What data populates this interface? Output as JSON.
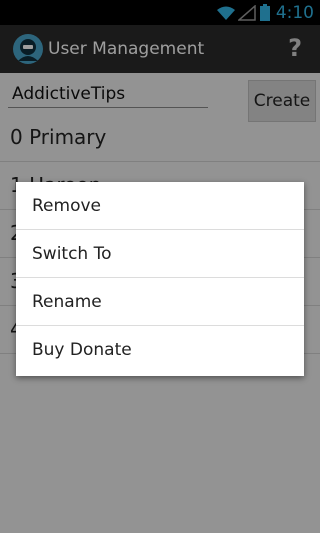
{
  "status_bar": {
    "time": "4:10",
    "icons": [
      "wifi-icon",
      "signal-icon",
      "battery-icon"
    ]
  },
  "action_bar": {
    "title": "User Management",
    "help_label": "?",
    "app_icon": "app-avatar-icon"
  },
  "form": {
    "name_value": "AddictiveTips",
    "create_label": "Create"
  },
  "users": [
    {
      "label": "0 Primary"
    },
    {
      "label": "1 Haroon"
    },
    {
      "label": "2"
    },
    {
      "label": "3"
    },
    {
      "label": "4"
    }
  ],
  "context_menu": {
    "items": [
      {
        "label": "Remove"
      },
      {
        "label": "Switch To"
      },
      {
        "label": "Rename"
      },
      {
        "label": "Buy Donate"
      }
    ]
  },
  "colors": {
    "accent": "#33b5e5",
    "action_bar": "#2a2a2a",
    "background": "#ededed"
  }
}
